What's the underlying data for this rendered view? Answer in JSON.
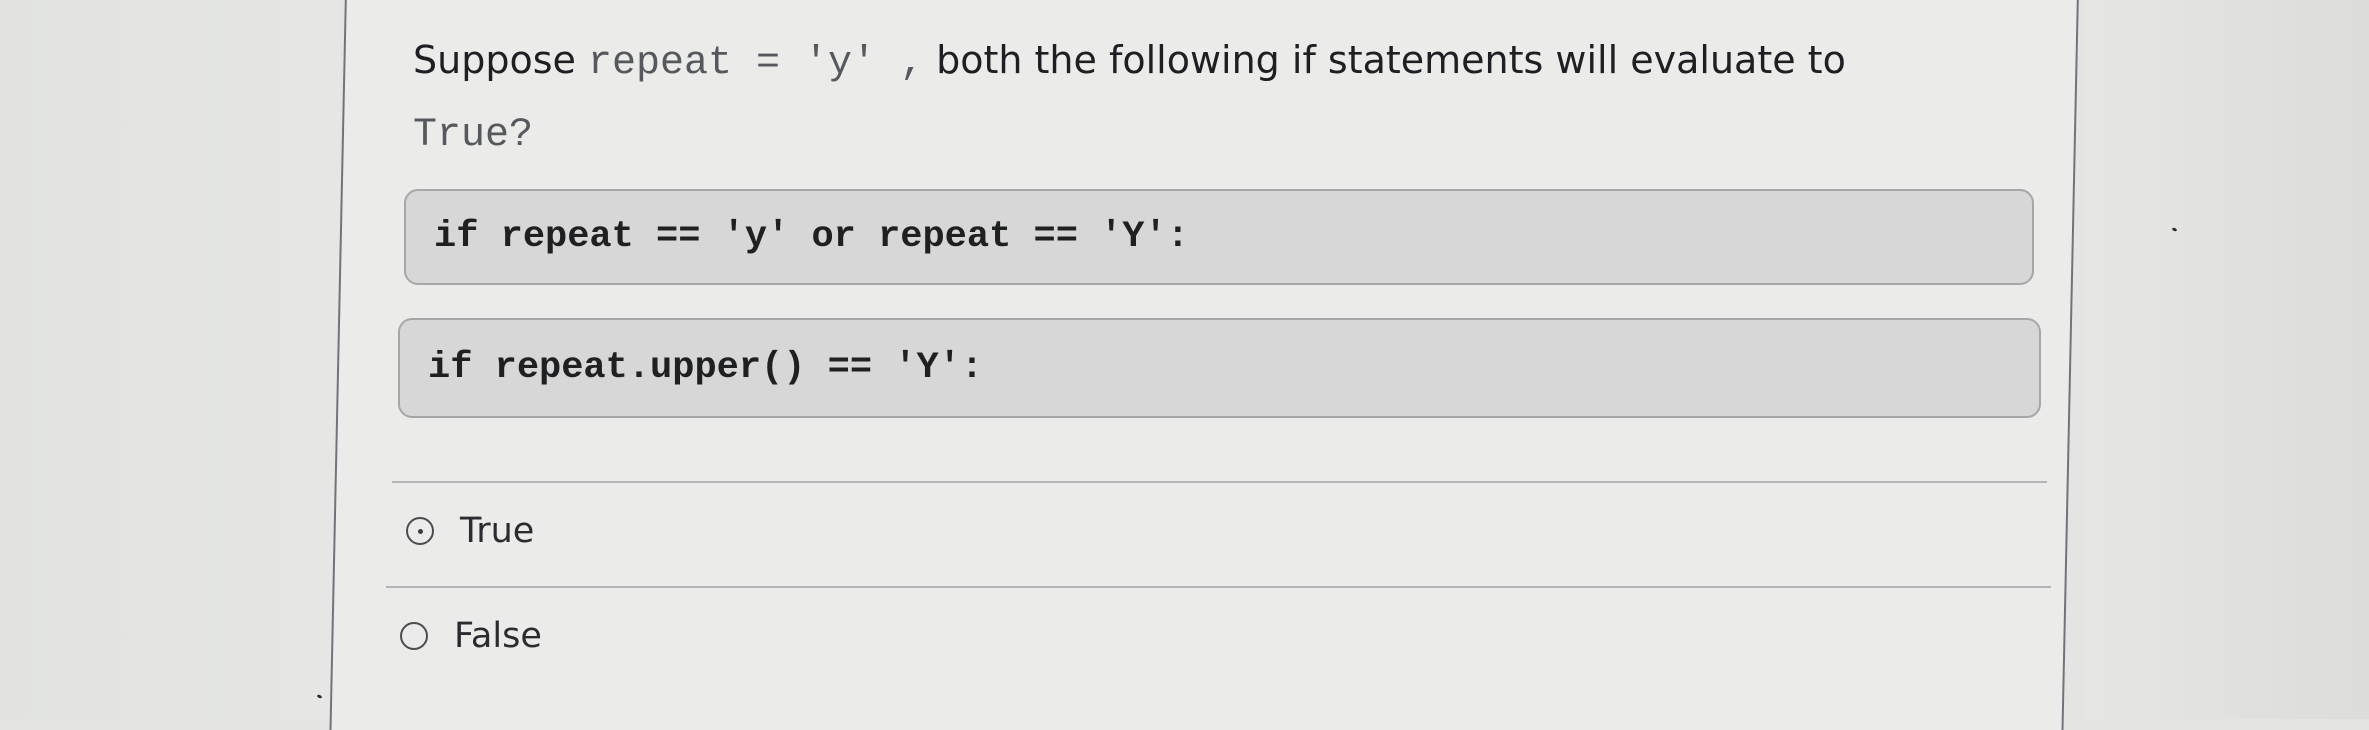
{
  "question": {
    "prefix": "Suppose ",
    "code_var": "repeat = 'y' ,",
    "suffix": " both the following if statements will evaluate to",
    "code_end": "True?"
  },
  "code_snippets": [
    "if repeat == 'y' or repeat == 'Y':",
    "if repeat.upper() == 'Y':"
  ],
  "options": [
    {
      "label": "True",
      "selected": true
    },
    {
      "label": "False",
      "selected": false
    }
  ],
  "colors": {
    "background": "#e4e5e3",
    "panel": "#ebecea",
    "code_box": "#d6d7d6",
    "text": "#1d1f22"
  }
}
